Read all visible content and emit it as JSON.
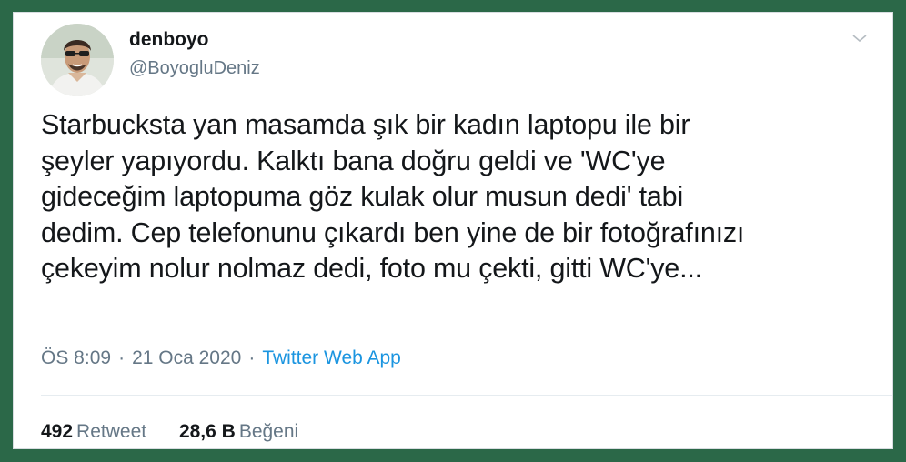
{
  "tweet": {
    "author": {
      "display_name": "denboyo",
      "handle": "@BoyogluDeniz",
      "avatar_icon": "user-avatar-photo"
    },
    "menu_icon": "chevron-down-icon",
    "text": "Starbucksta yan masamda şık bir kadın laptopu ile bir\nşeyler yapıyordu. Kalktı bana doğru geldi ve 'WC'ye\ngideceğim laptopuma göz kulak olur musun dedi' tabi\ndedim. Cep telefonunu çıkardı ben yine de bir fotoğrafınızı\nçekeyim nolur nolmaz dedi, foto mu çekti, gitti WC'ye...",
    "time": "ÖS 8:09",
    "separator": "·",
    "date": "21 Oca 2020",
    "source": "Twitter Web App",
    "stats": {
      "retweets_count": "492",
      "retweets_label": "Retweet",
      "likes_count": "28,6 B",
      "likes_label": "Beğeni"
    }
  },
  "colors": {
    "background": "#2b6848",
    "card": "#ffffff",
    "text": "#14171a",
    "muted": "#657786",
    "link": "#1b95e0"
  }
}
